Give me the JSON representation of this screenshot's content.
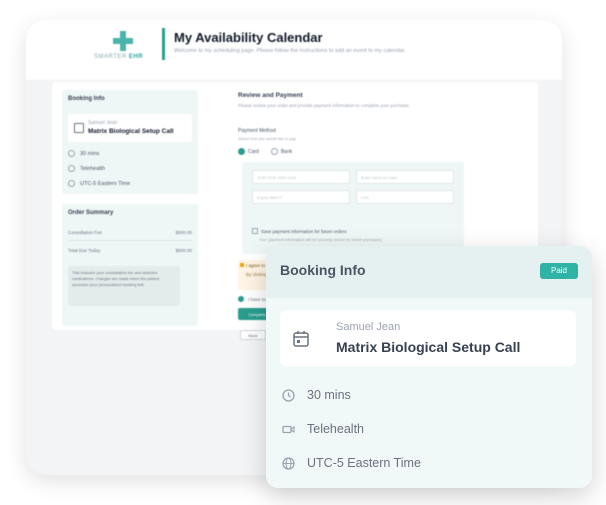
{
  "app": {
    "logo_text_left": "SMARTER",
    "logo_text_right": "EHR",
    "title": "My Availability Calendar",
    "subtitle": "Welcome to my scheduling page. Please follow the instructions to add an event to my calendar."
  },
  "left_panel": {
    "booking_heading": "Booking Info",
    "host": "Samuel Jean",
    "event": "Matrix Biological Setup Call",
    "duration": "30 mins",
    "location": "Telehealth",
    "timezone": "UTC-5 Eastern Time",
    "summary_heading": "Order Summary",
    "rows": [
      {
        "label": "Consultation Fee",
        "value": "$000.00"
      },
      {
        "label": "Total Due Today",
        "value": "$000.00"
      }
    ],
    "note": "This includes your consultation fee and selected medications. Charges are made when the patient accesses your personalized booking link."
  },
  "review": {
    "title": "Review and Payment",
    "subtitle": "Please review your order and provide payment information to complete your purchase.",
    "pm_label": "Payment Method",
    "pm_sub": "Select how you would like to pay",
    "option_card": "Card",
    "option_bank": "Bank",
    "card_number_placeholder": "1234 1234 1234 1234",
    "name_placeholder": "Enter name on Card",
    "expiry_placeholder": "Expiry MM/YY",
    "cvc_placeholder": "CVC",
    "save_label": "Save payment information for future orders",
    "save_note": "Your payment information will be securely stored for future purchases.",
    "agree_title": "I agree to the terms and conditions",
    "agree_body": "By clicking the button, you agree to our Terms and Privacy Policy.",
    "terms_label": "I have read and agree to the terms",
    "submit_label": "Complete Purchase",
    "back_label": "Back"
  },
  "booking_card": {
    "title": "Booking Info",
    "badge": "Paid",
    "host": "Samuel Jean",
    "event": "Matrix Biological Setup Call",
    "duration": "30 mins",
    "location": "Telehealth",
    "timezone": "UTC-5 Eastern Time"
  },
  "colors": {
    "accent": "#2a9d8f",
    "badge": "#2fb3a4",
    "card_bg": "#f1f8f8"
  }
}
